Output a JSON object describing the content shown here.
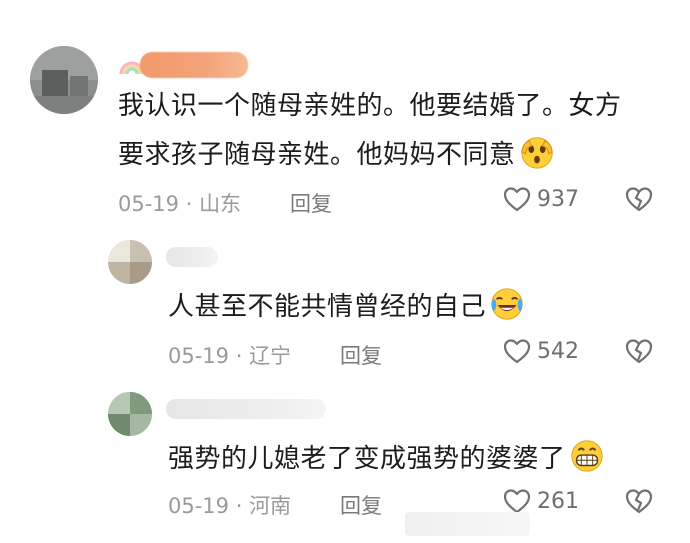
{
  "comments": [
    {
      "text_line1": "我认识一个随母亲姓的。他要结婚了。女方",
      "text_line2": "要求孩子随母亲姓。他妈妈不同意",
      "emoji": "shocked-face-emoji",
      "date": "05-19",
      "location": "山东",
      "reply_label": "回复",
      "likes": "937"
    },
    {
      "text": "人甚至不能共情曾经的自己",
      "emoji": "laughing-crying-emoji",
      "date": "05-19",
      "location": "辽宁",
      "reply_label": "回复",
      "likes": "542"
    },
    {
      "text": "强势的儿媳老了变成强势的婆婆了",
      "emoji": "grinning-face-emoji",
      "date": "05-19",
      "location": "河南",
      "reply_label": "回复",
      "likes": "261"
    }
  ],
  "meta_separator": " · ",
  "colors": {
    "text": "#1c1c1c",
    "meta": "#9a9a9a",
    "username_highlight": "#f29a6a"
  },
  "icons": {
    "like": "heart-outline-icon",
    "dislike": "broken-heart-icon",
    "badge": "rainbow-badge-icon"
  }
}
